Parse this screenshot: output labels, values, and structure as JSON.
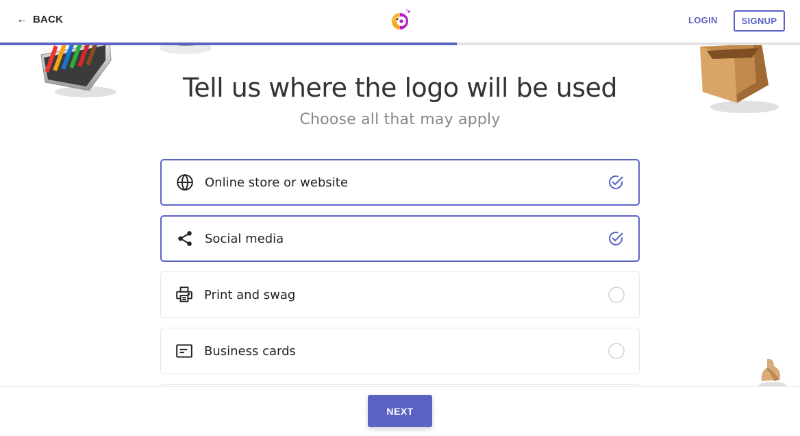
{
  "header": {
    "back_label": "BACK",
    "login_label": "LOGIN",
    "signup_label": "SIGNUP",
    "progress_fraction": 0.571
  },
  "main": {
    "title": "Tell us where the logo will be used",
    "subtitle": "Choose all that may apply",
    "options": [
      {
        "label": "Online store or website",
        "icon": "globe-icon",
        "selected": true
      },
      {
        "label": "Social media",
        "icon": "share-icon",
        "selected": true
      },
      {
        "label": "Print and swag",
        "icon": "printer-icon",
        "selected": false
      },
      {
        "label": "Business cards",
        "icon": "business-card-icon",
        "selected": false
      }
    ]
  },
  "footer": {
    "next_label": "NEXT"
  },
  "colors": {
    "accent": "#5a62c4",
    "text": "#222222",
    "muted": "#888888",
    "border": "#e4e4e4"
  }
}
